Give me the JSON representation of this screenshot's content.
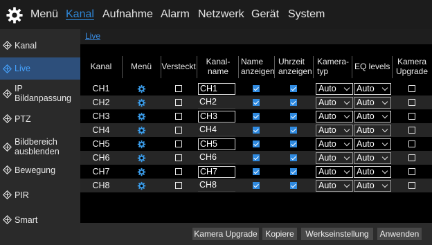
{
  "topnav": {
    "items": [
      "Menü",
      "Kanal",
      "Aufnahme",
      "Alarm",
      "Netzwerk",
      "Gerät",
      "System"
    ],
    "active": "Kanal"
  },
  "sidebar": {
    "items": [
      {
        "label": "Kanal"
      },
      {
        "label": "Live"
      },
      {
        "label": "IP\nBildanpassung"
      },
      {
        "label": "PTZ"
      },
      {
        "label": "Bildbereich\nausblenden"
      },
      {
        "label": "Bewegung"
      },
      {
        "label": "PIR"
      },
      {
        "label": "Smart"
      }
    ],
    "active": "Live"
  },
  "breadcrumb": "Live",
  "table": {
    "headers": [
      "Kanal",
      "Menü",
      "Versteckt",
      "Kanal-\nname",
      "Name\nanzeigen",
      "Uhrzeit\nanzeigen",
      "Kamera-\ntyp",
      "EQ levels",
      "Kamera\nUpgrade"
    ],
    "rows": [
      {
        "channel": "CH1",
        "hidden": false,
        "name": "CH1",
        "show_name": true,
        "show_time": true,
        "camera_type": "Auto",
        "eq_level": "Auto",
        "upgrade": false
      },
      {
        "channel": "CH2",
        "hidden": false,
        "name": "CH2",
        "show_name": true,
        "show_time": true,
        "camera_type": "Auto",
        "eq_level": "Auto",
        "upgrade": false
      },
      {
        "channel": "CH3",
        "hidden": false,
        "name": "CH3",
        "show_name": true,
        "show_time": true,
        "camera_type": "Auto",
        "eq_level": "Auto",
        "upgrade": false
      },
      {
        "channel": "CH4",
        "hidden": false,
        "name": "CH4",
        "show_name": true,
        "show_time": true,
        "camera_type": "Auto",
        "eq_level": "Auto",
        "upgrade": false
      },
      {
        "channel": "CH5",
        "hidden": false,
        "name": "CH5",
        "show_name": true,
        "show_time": true,
        "camera_type": "Auto",
        "eq_level": "Auto",
        "upgrade": false
      },
      {
        "channel": "CH6",
        "hidden": false,
        "name": "CH6",
        "show_name": true,
        "show_time": true,
        "camera_type": "Auto",
        "eq_level": "Auto",
        "upgrade": false
      },
      {
        "channel": "CH7",
        "hidden": false,
        "name": "CH7",
        "show_name": true,
        "show_time": true,
        "camera_type": "Auto",
        "eq_level": "Auto",
        "upgrade": false
      },
      {
        "channel": "CH8",
        "hidden": false,
        "name": "CH8",
        "show_name": true,
        "show_time": true,
        "camera_type": "Auto",
        "eq_level": "Auto",
        "upgrade": false
      }
    ]
  },
  "buttons": {
    "camera_upgrade": "Kamera Upgrade",
    "copy": "Kopiere",
    "factory_default": "Werkseinstellung",
    "apply": "Anwenden"
  },
  "colors": {
    "accent": "#2f86d6",
    "active_sidebar_bg": "#2d4f7b",
    "active_sidebar_text": "#46a3ff",
    "checkbox_on": "#2f8ae0",
    "menu_gear": "#3a9be8"
  },
  "icons": {
    "main": "gear-icon",
    "row_menu": "gear-icon",
    "sidebar_bullet": "diamond-icon"
  }
}
